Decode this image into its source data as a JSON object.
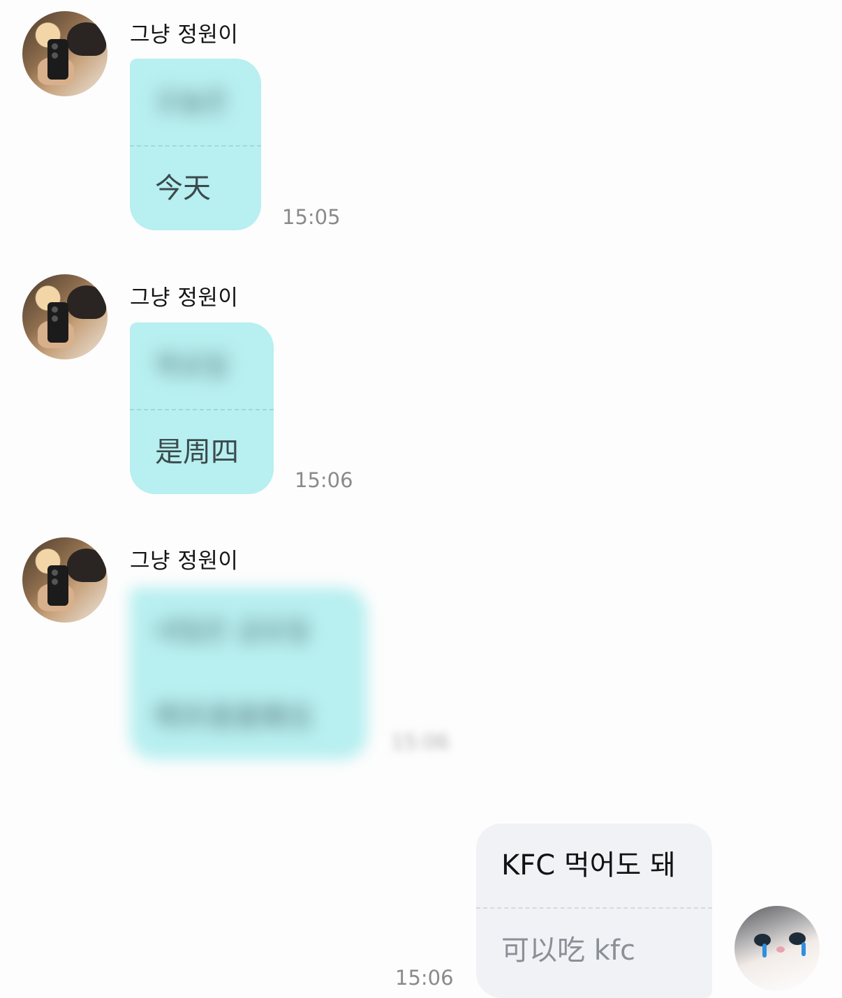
{
  "messages": [
    {
      "sender": "그냥 정원이",
      "original": "오늘은",
      "translation": "今天",
      "time": "15:05"
    },
    {
      "sender": "그냥 정원이",
      "original": "목요일",
      "translation": "是周四",
      "time": "15:06"
    },
    {
      "sender": "그냥 정원이",
      "original": "내일은 금요일",
      "translation": "明天是星期五",
      "time": "15:06"
    },
    {
      "original": "KFC 먹어도 돼",
      "translation": "可以吃 kfc",
      "time": "15:06"
    }
  ],
  "colors": {
    "incoming_bubble": "#b8eff0",
    "outgoing_bubble": "#f1f2f6",
    "timestamp": "#8a8a8a",
    "background": "#fdfdfd"
  },
  "icons": {
    "sender_avatar": "profile-photo",
    "my_avatar": "crying-kitten-photo"
  }
}
